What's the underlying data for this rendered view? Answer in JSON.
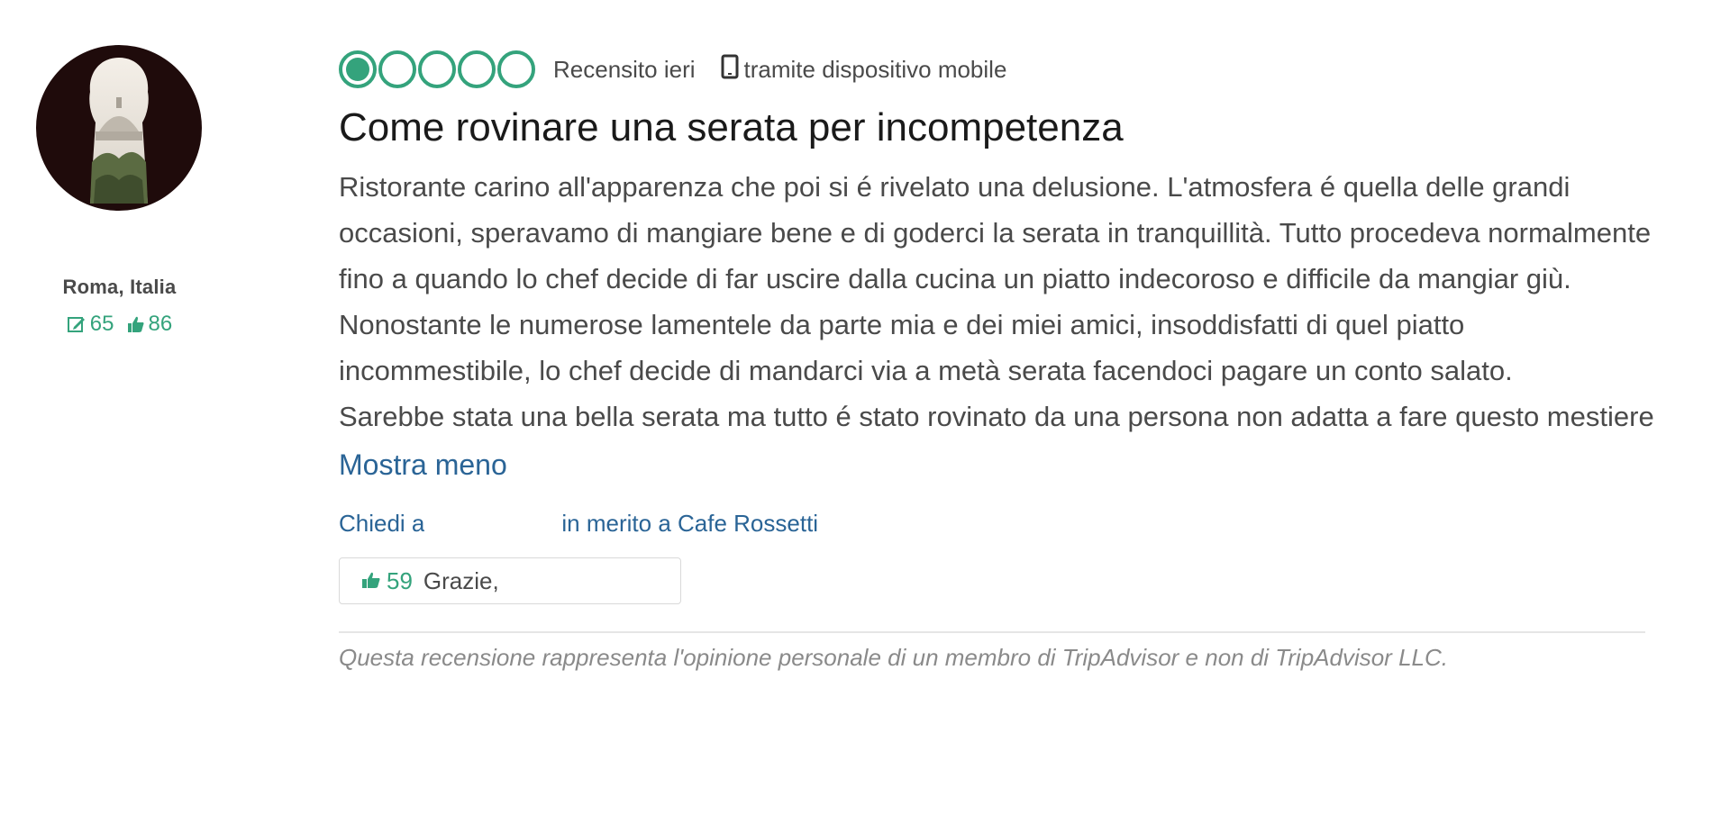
{
  "member": {
    "location": "Roma, Italia",
    "reviews_count": "65",
    "helpful_votes": "86"
  },
  "review": {
    "rating": 1,
    "rating_max": 5,
    "date": "Recensito ieri",
    "device": "tramite dispositivo mobile",
    "title": "Come rovinare una serata per incompetenza",
    "body_paragraphs": [
      "Ristorante carino all'apparenza che poi si é rivelato una delusione. L'atmosfera é quella delle grandi occasioni, speravamo di mangiare bene e di goderci la serata in tranquillità. Tutto procedeva normalmente fino a quando lo chef decide di far uscire dalla cucina un piatto indecoroso e difficile da mangiar giù. Nonostante le numerose lamentele da parte mia e dei miei amici, insoddisfatti di quel piatto incommestibile, lo chef decide di mandarci via a metà serata facendoci pagare un conto salato.",
      "Sarebbe stata una bella serata ma tutto é stato rovinato da una persona non adatta a fare questo mestiere"
    ],
    "show_less": "Mostra meno",
    "ask_prefix": "Chiedi a",
    "ask_suffix": "in merito a Cafe Rossetti",
    "helpful_count": "59",
    "thanks_label": "Grazie,",
    "disclaimer": "Questa recensione rappresenta l'opinione personale di un membro di TripAdvisor e non di TripAdvisor LLC."
  },
  "colors": {
    "accent_green": "#34a37c",
    "link_blue": "#2a6496"
  },
  "icons": {
    "review_count": "pencil-square-icon",
    "helpful_votes": "thumbs-up-icon",
    "device": "mobile-phone-icon"
  }
}
